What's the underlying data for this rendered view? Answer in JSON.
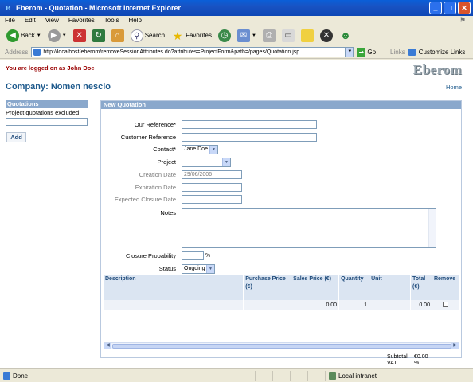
{
  "window": {
    "title": "Eberom - Quotation - Microsoft Internet Explorer",
    "buttons": [
      "_",
      "□",
      "✕"
    ]
  },
  "menu": [
    "File",
    "Edit",
    "View",
    "Favorites",
    "Tools",
    "Help"
  ],
  "toolbar": {
    "back": "Back",
    "search": "Search",
    "favorites": "Favorites"
  },
  "address": {
    "label": "Address",
    "url": "http://localhost/eberom/removeSessionAttributes.do?attributes=ProjectForm&path=/pages/Quotation.jsp",
    "go": "Go",
    "links": "Links",
    "customize": "Customize Links"
  },
  "page": {
    "logon_text": "You are logged on as John Doe",
    "brand": "Eberom",
    "company": "Company: Nomen nescio",
    "home": "Home"
  },
  "left": {
    "header": "Quotations",
    "text": "Project quotations excluded",
    "add_button": "Add"
  },
  "form": {
    "header": "New Quotation",
    "our_reference_label": "Our Reference*",
    "customer_reference_label": "Customer Reference",
    "contact_label": "Contact*",
    "contact_value": "Jane Doe",
    "project_label": "Project",
    "project_value": "",
    "creation_date_label": "Creation Date",
    "creation_date_value": "29/06/2006",
    "expiration_date_label": "Expiration Date",
    "expected_closure_label": "Expected Closure Date",
    "notes_label": "Notes",
    "closure_probability_label": "Closure Probability",
    "percent": "%",
    "status_label": "Status",
    "status_value": "Ongoing"
  },
  "grid": {
    "columns": [
      "Description",
      "Purchase Price (€)",
      "Sales Price (€)",
      "Quantity",
      "Unit",
      "Total (€)",
      "Remove"
    ],
    "rows": [
      {
        "description": "",
        "purchase_price": "",
        "sales_price": "0.00",
        "quantity": "1",
        "unit": "",
        "total": "0.00"
      }
    ]
  },
  "totals": {
    "subtotal_label": "Subtotal",
    "subtotal_value": "€0.00",
    "vat_label": "VAT",
    "vat_value": "%"
  },
  "status": {
    "done": "Done",
    "zone": "Local intranet"
  }
}
